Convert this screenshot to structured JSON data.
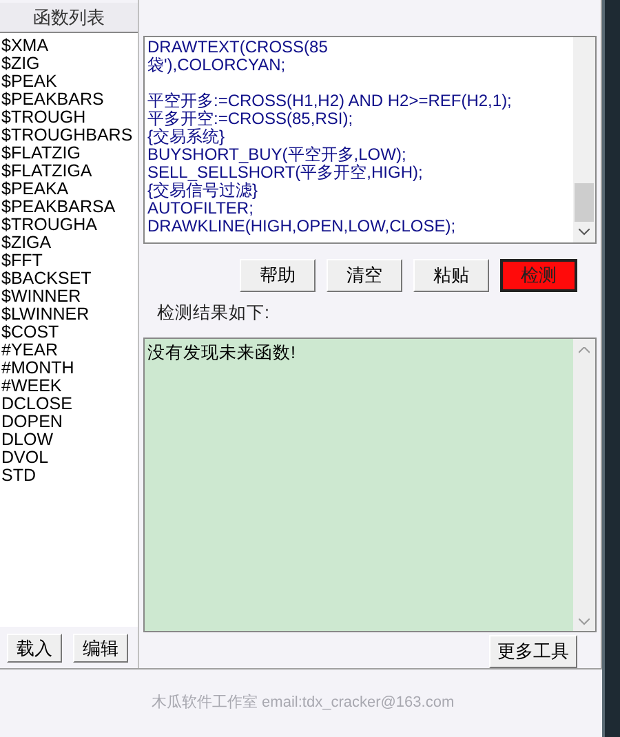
{
  "function_list": {
    "title": "函数列表",
    "items": [
      "$XMA",
      "$ZIG",
      "$PEAK",
      "$PEAKBARS",
      "$TROUGH",
      "$TROUGHBARS",
      "$FLATZIG",
      "$FLATZIGA",
      "$PEAKA",
      "$PEAKBARSA",
      "$TROUGHA",
      "$ZIGA",
      "$FFT",
      "$BACKSET",
      "$WINNER",
      "$LWINNER",
      "$COST",
      "#YEAR",
      "#MONTH",
      "#WEEK",
      "DCLOSE",
      "DOPEN",
      "DLOW",
      "DVOL",
      "STD"
    ],
    "buttons": [
      "载入",
      "编辑"
    ]
  },
  "editor": {
    "lines_top": [
      "DRAWTEXT(CROSS(85",
      "袋'),COLORCYAN;"
    ],
    "lines_bottom": [
      "平空开多:=CROSS(H1,H2) AND H2>=REF(H2,1);",
      "平多开空:=CROSS(85,RSI);",
      "{交易系统}",
      "BUYSHORT_BUY(平空开多,LOW);",
      "SELL_SELLSHORT(平多开空,HIGH);",
      "{交易信号过滤}",
      "AUTOFILTER;",
      "DRAWKLINE(HIGH,OPEN,LOW,CLOSE);"
    ]
  },
  "actions": [
    {
      "label": "帮助",
      "kind": "normal"
    },
    {
      "label": "清空",
      "kind": "normal"
    },
    {
      "label": "粘贴",
      "kind": "normal"
    },
    {
      "label": "检测",
      "kind": "primary"
    }
  ],
  "result": {
    "label": "检测结果如下:",
    "text": "没有发现未来函数!"
  },
  "more_tools": "更多工具",
  "footer": "木瓜软件工作室 email:tdx_cracker@163.com"
}
